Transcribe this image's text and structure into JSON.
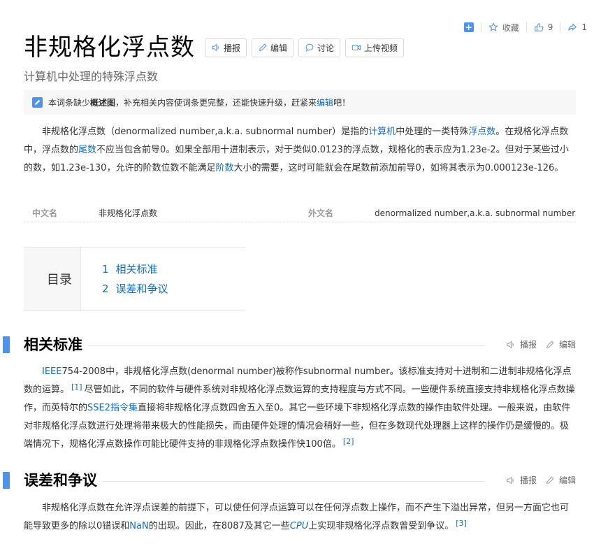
{
  "topbar": {
    "add_label": "+",
    "favorite_label": "收藏",
    "like_count": "9",
    "share_count": "1"
  },
  "title": "非规格化浮点数",
  "title_buttons": {
    "play": "播报",
    "edit": "编辑",
    "discuss": "讨论",
    "upload_video": "上传视频"
  },
  "subtitle": "计算机中处理的特殊浮点数",
  "notice": {
    "pre": "本词条缺少",
    "bold": "概述图",
    "mid": "，补充相关内容使词条更完整，还能快速升级，赶紧来",
    "link": "编辑",
    "post": "吧！"
  },
  "summary": {
    "t1": "非规格化浮点数（denormalized number,a.k.a. subnormal number）是指的",
    "l1": "计算机",
    "t2": "中处理的一类特殊",
    "l2": "浮点数",
    "t3": "。在规格化浮点数中，浮点数的",
    "l3": "尾数",
    "t4": "不应当包含前导0。如果全部用十进制表示，对于类似0.0123的浮点数，规格化的表示应为1.23e-2。但对于某些过小的数，如1.23e-130，允许的阶数位数不能满足",
    "l4": "阶数",
    "t5": "大小的需要，这时可能就会在尾数前添加前导0，如将其表示为0.000123e-126。"
  },
  "basic_info": {
    "k1": "中文名",
    "v1": "非规格化浮点数",
    "k2": "外文名",
    "v2": "denormalized number,a.k.a. subnormal number"
  },
  "toc": {
    "label": "目录",
    "items": [
      {
        "num": "1",
        "label": "相关标准"
      },
      {
        "num": "2",
        "label": "误差和争议"
      }
    ]
  },
  "section_tools": {
    "play": "播报",
    "edit": "编辑"
  },
  "sections": [
    {
      "title": "相关标准",
      "l1": "IEEE",
      "t1": "754-2008中，非规格化浮点数(denormal number)被称作subnormal number。该标准支持对十进制和二进制非规格化浮点数的运算。",
      "ref1": "[1]",
      "t2": "尽管如此，不同的软件与硬件系统对非规格化浮点数运算的支持程度与方式不同。一些硬件系统直接支持非规格化浮点数操作，而英特尔的",
      "l2": "SSE2指令集",
      "t3": "直接将非规格化浮点数四舍五入至0。其它一些环境下非规格化浮点数的操作由软件处理。一般来说，由软件对非规格化浮点数进行处理将带来极大的性能损失，而由硬件处理的情况会稍好一些，但在多数现代处理器上这样的操作仍是缓慢的。极端情况下，规格化浮点数操作可能比硬件支持的非规格化浮点数操作快100倍。",
      "ref2": "[2]"
    },
    {
      "title": "误差和争议",
      "t1": "非规格化浮点数在允许浮点误差的前提下，可以使任何浮点运算可以在任何浮点数上操作，而不产生下溢出异常，但另一方面它也可能导致更多的除以0错误和",
      "l1": "NaN",
      "t2": "的出现。因此，在8087及其它一些",
      "l2": "CPU",
      "t3": "上实现非规格化浮点数曾受到争议。",
      "ref1": "[3]"
    }
  ],
  "colors": {
    "accent": "#4e93e8",
    "link": "#136ec2"
  }
}
